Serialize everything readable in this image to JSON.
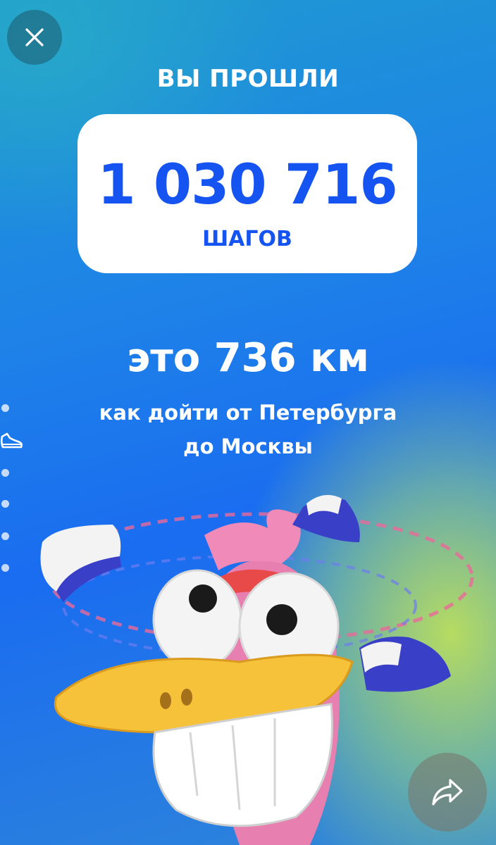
{
  "header": {
    "close_icon": "close-icon",
    "title": "ВЫ ПРОШЛИ"
  },
  "steps": {
    "value": "1 030 716",
    "unit": "ШАГОВ"
  },
  "distance": {
    "text": "это 736 км"
  },
  "comparison": {
    "line1": "как дойти от Петербурга",
    "line2": "до Москвы"
  },
  "pager": {
    "total": 6,
    "active_index": 1,
    "active_icon": "sneaker-icon"
  },
  "actions": {
    "share_icon": "share-icon"
  },
  "colors": {
    "accent": "#1554F0",
    "card": "#FFFFFF"
  }
}
